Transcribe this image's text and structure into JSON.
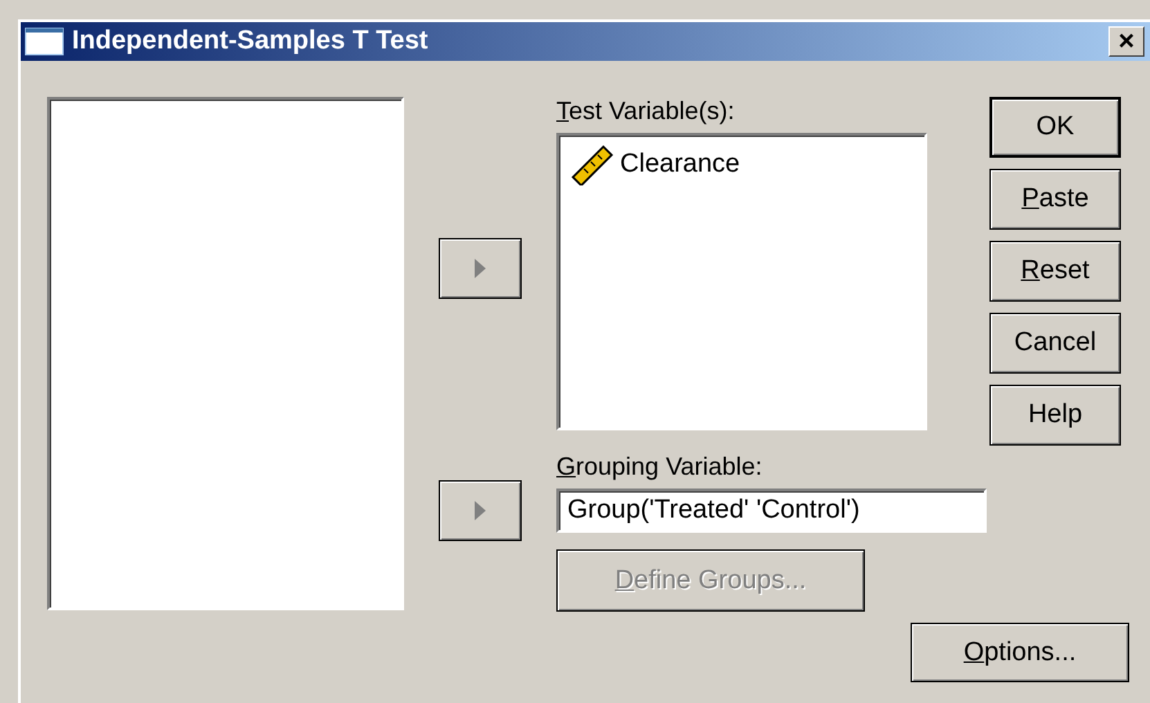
{
  "window": {
    "title": "Independent-Samples T Test",
    "close": "×"
  },
  "test_variables": {
    "label": "Test Variable(s):",
    "underline_first": true,
    "items": [
      {
        "name": "Clearance",
        "kind": "scale"
      }
    ]
  },
  "grouping_variable": {
    "label": "Grouping Variable:",
    "underline_first": true,
    "value": "Group('Treated' 'Control')"
  },
  "move_buttons": [
    {
      "disabled": true
    },
    {
      "disabled": true
    }
  ],
  "define_groups": {
    "label": "Define Groups...",
    "underline_first": true,
    "disabled": true
  },
  "buttons": [
    {
      "label": "OK",
      "default": true,
      "underline_first": false
    },
    {
      "label": "Paste",
      "default": false,
      "underline_first": true
    },
    {
      "label": "Reset",
      "default": false,
      "underline_first": true
    },
    {
      "label": "Cancel",
      "default": false,
      "underline_first": false
    },
    {
      "label": "Help",
      "default": false,
      "underline_first": false
    }
  ],
  "options_button": {
    "label": "Options...",
    "underline_first": true
  }
}
